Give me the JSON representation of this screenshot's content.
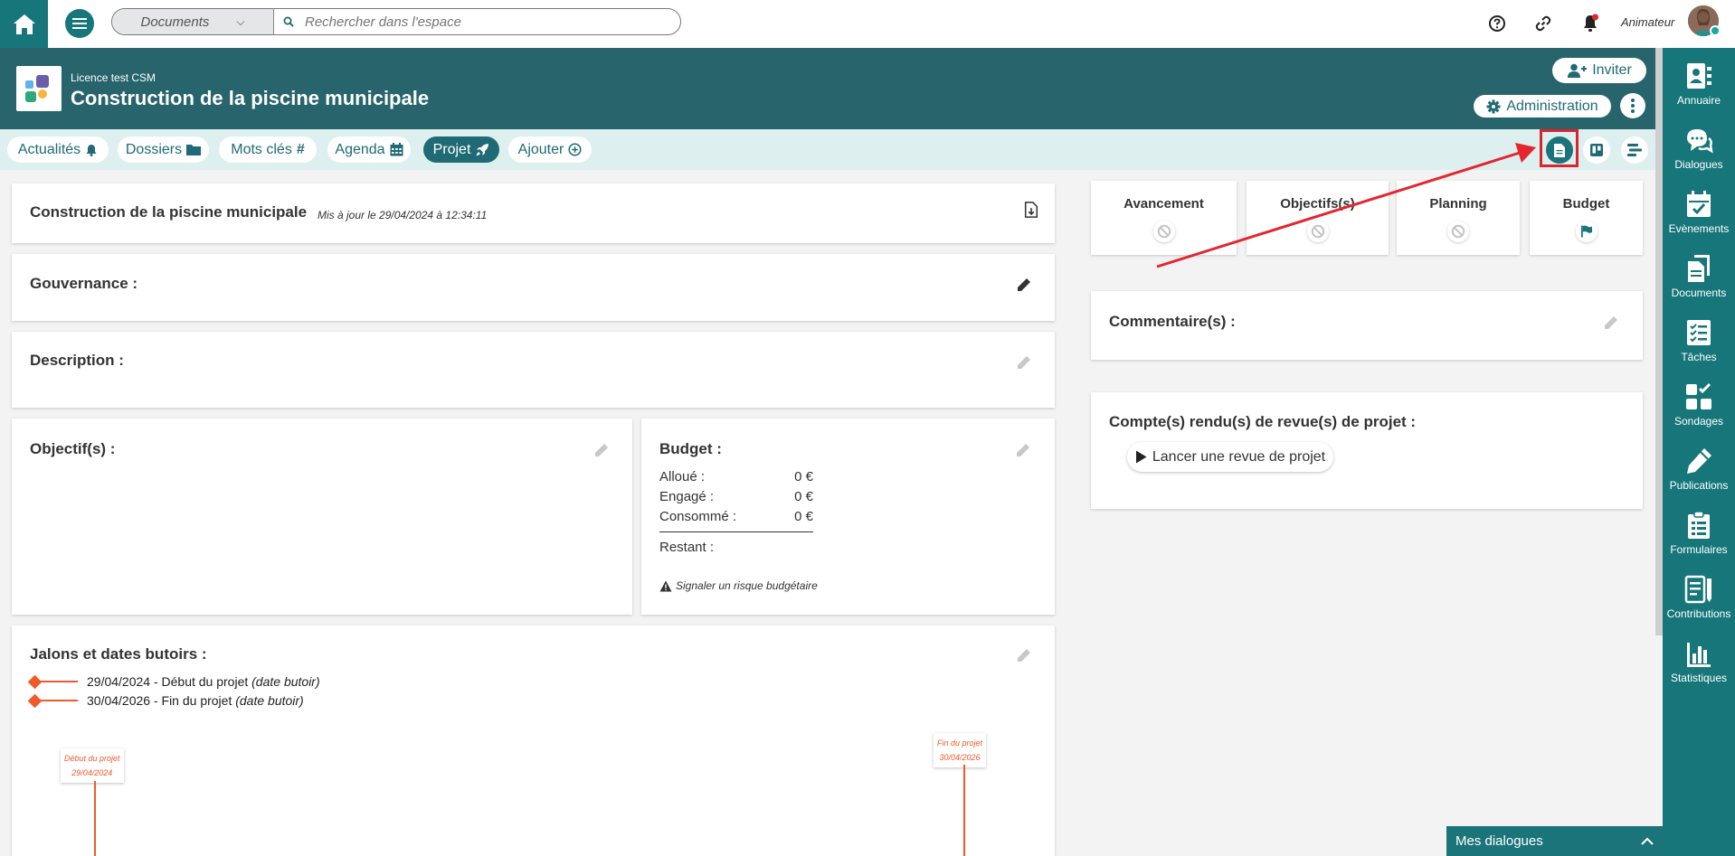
{
  "topbar": {
    "search_scope": "Documents",
    "search_placeholder": "Rechercher dans l'espace",
    "role": "Animateur"
  },
  "header": {
    "licence": "Licence test CSM",
    "title": "Construction de la piscine municipale",
    "invite_label": "Inviter",
    "admin_label": "Administration"
  },
  "tabs": [
    {
      "label": "Actualités"
    },
    {
      "label": "Dossiers"
    },
    {
      "label": "Mots clés"
    },
    {
      "label": "Agenda"
    },
    {
      "label": "Projet"
    },
    {
      "label": "Ajouter"
    }
  ],
  "project": {
    "title": "Construction de la piscine municipale",
    "updated": "Mis à jour le 29/04/2024 à 12:34:11"
  },
  "sections": {
    "gouvernance": "Gouvernance :",
    "description": "Description :",
    "objectifs": "Objectif(s) :",
    "budget": "Budget :",
    "jalons": "Jalons et dates butoirs :",
    "commentaires": "Commentaire(s) :",
    "revues": "Compte(s) rendu(s) de revue(s) de projet :"
  },
  "budget": {
    "rows": [
      {
        "label": "Alloué :",
        "value": "0 €"
      },
      {
        "label": "Engagé :",
        "value": "0 €"
      },
      {
        "label": "Consommé :",
        "value": "0 €"
      }
    ],
    "restant_label": "Restant :",
    "risk_label": "Signaler un risque budgétaire"
  },
  "jalons": [
    {
      "date": "29/04/2024",
      "label": " - Début du projet ",
      "type": "(date butoir)"
    },
    {
      "date": "30/04/2026",
      "label": " - Fin du projet ",
      "type": "(date butoir)"
    }
  ],
  "timeline": [
    {
      "name": "Début du projet",
      "date": "29/04/2024"
    },
    {
      "name": "Fin du projet",
      "date": "30/04/2026"
    }
  ],
  "kpis": [
    {
      "label": "Avancement",
      "icon": "ban-icon"
    },
    {
      "label": "Objectifs(s)",
      "icon": "ban-icon"
    },
    {
      "label": "Planning",
      "icon": "ban-icon"
    },
    {
      "label": "Budget",
      "icon": "flag-icon"
    }
  ],
  "review_button": "Lancer une revue de projet",
  "rail": [
    {
      "label": "Annuaire"
    },
    {
      "label": "Dialogues"
    },
    {
      "label": "Evènements"
    },
    {
      "label": "Documents"
    },
    {
      "label": "Tâches"
    },
    {
      "label": "Sondages"
    },
    {
      "label": "Publications"
    },
    {
      "label": "Formulaires"
    },
    {
      "label": "Contributions"
    },
    {
      "label": "Statistiques"
    }
  ],
  "footer": {
    "dialogues_label": "Mes dialogues"
  },
  "colors": {
    "brand": "#17767a",
    "header": "#27646c",
    "accent": "#f05a2a",
    "annotation": "#d9252b"
  }
}
